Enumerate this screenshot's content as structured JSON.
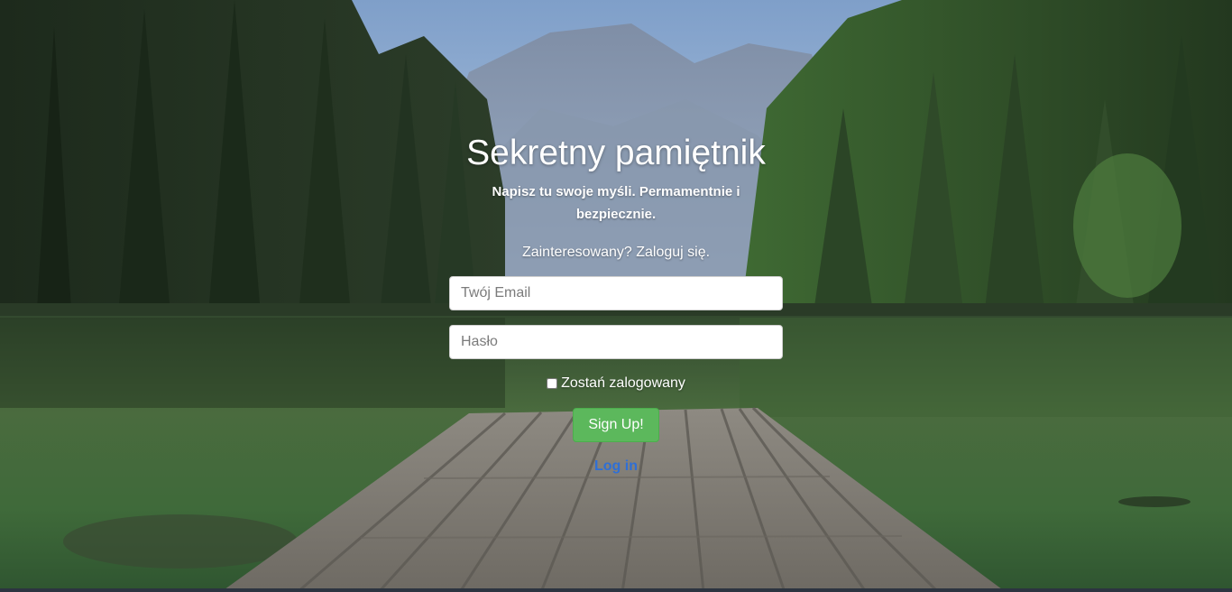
{
  "hero": {
    "title": "Sekretny pamiętnik",
    "subtitle": "Napisz tu swoje myśli. Permamentnie i bezpiecznie.",
    "prompt": "Zainteresowany? Zaloguj się."
  },
  "form": {
    "email_placeholder": "Twój Email",
    "password_placeholder": "Hasło",
    "remember_label": "Zostań zalogowany",
    "remember_checked": false,
    "signup_label": "Sign Up!",
    "login_link": "Log in"
  },
  "colors": {
    "signup_button": "#5cb85c",
    "link": "#2f6fd6",
    "text": "#ffffff"
  },
  "background": {
    "scene": "forest-lake-mountains-wooden-pier"
  }
}
